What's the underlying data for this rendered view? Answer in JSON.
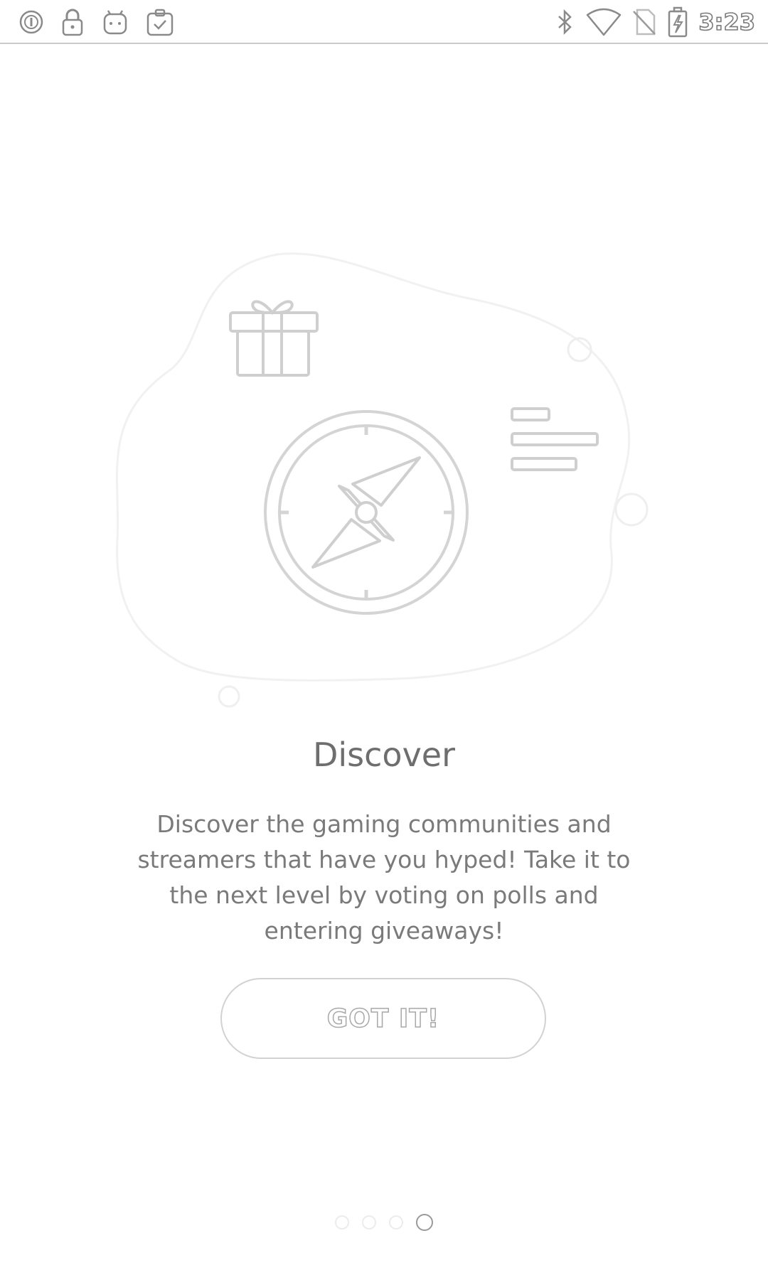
{
  "status_bar": {
    "time": "3:23",
    "left_icons": [
      "alert-circle-icon",
      "lock-icon",
      "android-icon",
      "clipboard-check-icon"
    ],
    "right_icons": [
      "bluetooth-icon",
      "wifi-icon",
      "no-sim-icon",
      "battery-charging-icon"
    ]
  },
  "onboarding": {
    "illustration_icons": [
      "gift-icon",
      "compass-icon",
      "list-lines-icon"
    ],
    "title": "Discover",
    "description": "Discover the gaming communities and streamers that have you hyped! Take it to the next level by voting on polls and entering giveaways!",
    "button_label": "GOT IT!"
  },
  "pager": {
    "total_pages": 4,
    "current_page": 4
  },
  "colors": {
    "background": "#ffffff",
    "text": "#6e6e6e",
    "outline": "#d2d2d2",
    "active_dot": "#9a9a9a"
  }
}
